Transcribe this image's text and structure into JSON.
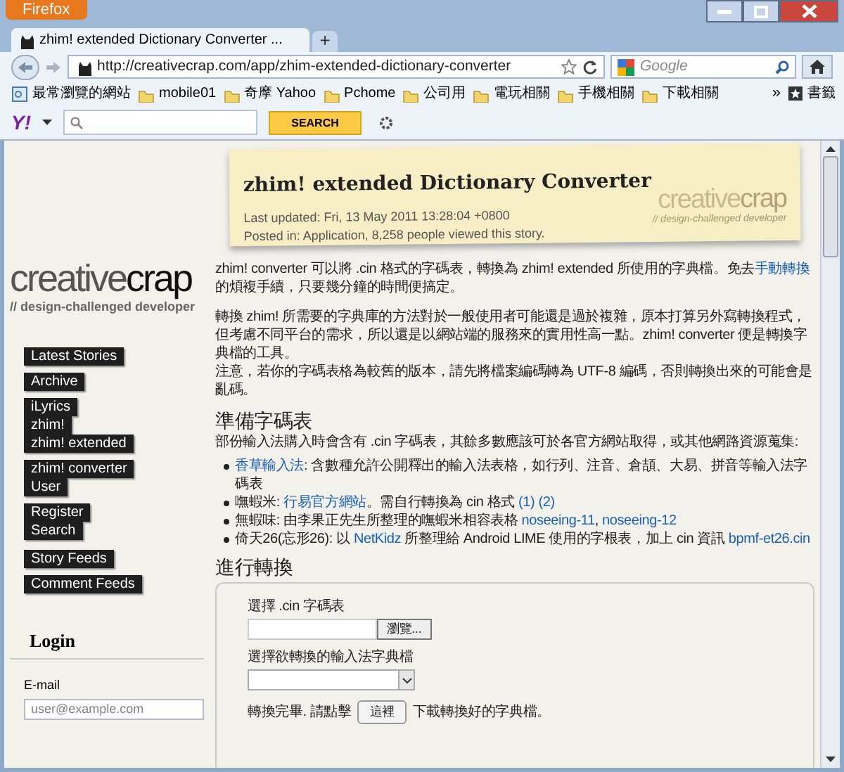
{
  "window": {
    "app_button": "Firefox"
  },
  "tabs": [
    {
      "title": "zhim! extended Dictionary Converter ...",
      "selected": true
    }
  ],
  "new_tab": "+",
  "address": "http://creativecrap.com/app/zhim-extended-dictionary-converter",
  "search_placeholder": "Google",
  "bookmarks": [
    {
      "label": "最常瀏覽的網站",
      "kind": "smart"
    },
    {
      "label": "mobile01",
      "kind": "folder"
    },
    {
      "label": "奇摩 Yahoo",
      "kind": "folder"
    },
    {
      "label": "Pchome",
      "kind": "folder"
    },
    {
      "label": "公司用",
      "kind": "folder"
    },
    {
      "label": "電玩相關",
      "kind": "folder"
    },
    {
      "label": "手機相關",
      "kind": "folder"
    },
    {
      "label": "下載相關",
      "kind": "folder"
    }
  ],
  "bookmarks_more": "»",
  "bookmarks_menu": "書籤",
  "yahoo_toolbar": {
    "logo": "Y!",
    "button": "SEARCH"
  },
  "sidebar": {
    "logo_light": "creative",
    "logo_dark": "crap",
    "tagline": "// design-challenged developer",
    "nav_groups": [
      [
        "Latest Stories"
      ],
      [
        "Archive"
      ],
      [
        "iLyrics",
        "zhim!",
        "zhim! extended"
      ],
      [
        "zhim! converter",
        "User"
      ],
      [
        "Register",
        "Search"
      ],
      [
        "Story Feeds"
      ],
      [
        "Comment Feeds"
      ]
    ],
    "login": {
      "title": "Login",
      "email_label": "E-mail",
      "email_placeholder": "user@example.com"
    }
  },
  "article": {
    "title": "zhim! extended Dictionary Converter",
    "meta": [
      "Last updated: Fri, 13 May 2011 13:28:04 +0800",
      "Posted in: Application, 8,258 people viewed this story."
    ],
    "watermark": {
      "light": "creative",
      "dark": "crap",
      "tagline": "// design-challenged developer"
    },
    "paragraphs": [
      [
        {
          "text": "zhim! converter 可以將 .cin 格式的字碼表，轉換為 zhim! extended 所使用的字典檔。免去",
          "link": false
        },
        {
          "text": "手動轉換",
          "link": true
        },
        {
          "text": "的煩複手續，只要幾分鐘的時間便搞定。",
          "link": false
        }
      ],
      [
        {
          "text": "轉換 zhim! 所需要的字典庫的方法對於一般使用者可能還是過於複雜，原本打算另外寫轉換程式，但考慮不同平台的需求，所以還是以網站端的服務來的實用性高一點。zhim! converter 便是轉換字典檔的工具。",
          "link": false
        }
      ]
    ],
    "note": "注意，若你的字碼表格為較舊的版本，請先將檔案編碼轉為 UTF-8 編碼，否則轉換出來的可能會是亂碼。",
    "prepare": {
      "heading": "準備字碼表",
      "intro": "部份輸入法購入時會含有 .cin 字碼表，其餘多數應該可於各官方網站取得，或其他網路資源蒐集:",
      "bullets": [
        [
          {
            "text": "香草輸入法",
            "link": true
          },
          {
            "text": ": 含數種允許公開釋出的輸入法表格，如行列、注音、倉頡、大易、拼音等輸入法字碼表",
            "link": false
          }
        ],
        [
          {
            "text": "嘸蝦米: ",
            "link": false
          },
          {
            "text": "行易官方網站",
            "link": true
          },
          {
            "text": "。需自行轉換為 cin 格式 ",
            "link": false
          },
          {
            "text": "(1)",
            "link": true
          },
          {
            "text": "(2)",
            "link": true
          }
        ],
        [
          {
            "text": "無蝦味: 由李果正先生所整理的嘸蝦米相容表格 ",
            "link": false
          },
          {
            "text": "noseeing-11",
            "link": true
          },
          {
            "text": ", ",
            "link": false
          },
          {
            "text": "noseeing-12",
            "link": true
          }
        ],
        [
          {
            "text": "倚天26(忘形26): 以 ",
            "link": false
          },
          {
            "text": "NetKidz",
            "link": true
          },
          {
            "text": " 所整理給 Android LIME 使用的字根表，加上 cin 資訊 ",
            "link": false
          },
          {
            "text": "bpmf-et26.cin",
            "link": true
          }
        ]
      ]
    },
    "convert": {
      "heading": "進行轉換",
      "file_label": "選擇 .cin 字碼表",
      "browse_button": "瀏覽...",
      "dict_label": "選擇欲轉換的輸入法字典檔",
      "done_text": "轉換完畢. 請點擊",
      "here_button": "這裡",
      "after_text": "下載轉換好的字典檔。"
    }
  }
}
